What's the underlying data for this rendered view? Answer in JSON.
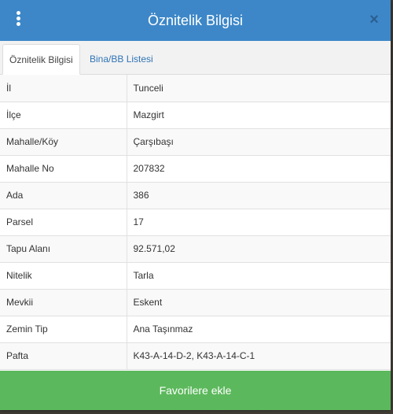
{
  "header": {
    "title": "Öznitelik Bilgisi",
    "close_label": "×"
  },
  "tabs": [
    {
      "label": "Öznitelik Bilgisi",
      "active": true
    },
    {
      "label": "Bina/BB Listesi",
      "active": false
    }
  ],
  "attributes": [
    {
      "key": "İl",
      "value": "Tunceli"
    },
    {
      "key": "İlçe",
      "value": "Mazgirt"
    },
    {
      "key": "Mahalle/Köy",
      "value": "Çarşıbaşı"
    },
    {
      "key": "Mahalle No",
      "value": "207832"
    },
    {
      "key": "Ada",
      "value": "386"
    },
    {
      "key": "Parsel",
      "value": "17"
    },
    {
      "key": "Tapu Alanı",
      "value": "92.571,02"
    },
    {
      "key": "Nitelik",
      "value": "Tarla"
    },
    {
      "key": "Mevkii",
      "value": "Eskent"
    },
    {
      "key": "Zemin Tip",
      "value": "Ana Taşınmaz"
    },
    {
      "key": "Pafta",
      "value": "K43-A-14-D-2, K43-A-14-C-1"
    }
  ],
  "footer": {
    "favorite_label": "Favorilere ekle"
  },
  "colors": {
    "header_bg": "#3d87c8",
    "link": "#2f74b5",
    "success": "#5cb85c"
  },
  "icons": {
    "menu": "vertical-ellipsis-icon",
    "close": "close-icon"
  }
}
